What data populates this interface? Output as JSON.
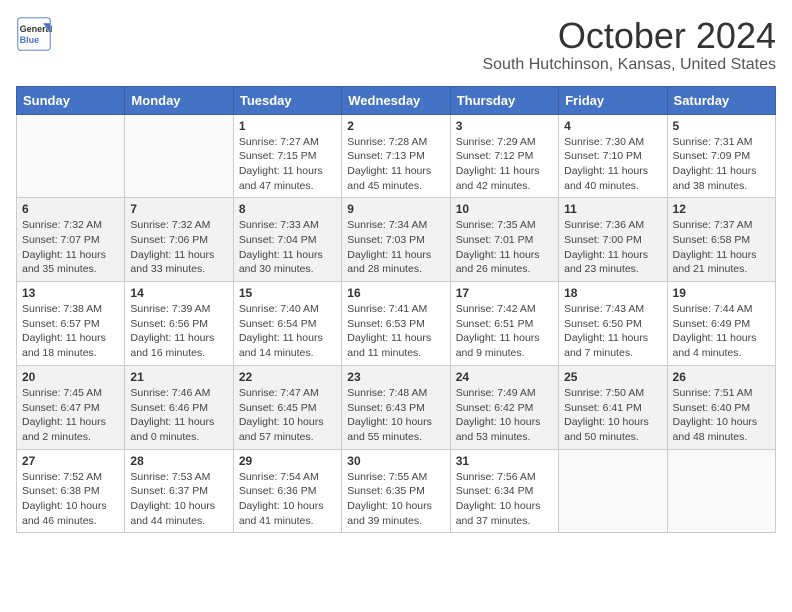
{
  "header": {
    "logo_line1": "General",
    "logo_line2": "Blue",
    "month_year": "October 2024",
    "location": "South Hutchinson, Kansas, United States"
  },
  "days_of_week": [
    "Sunday",
    "Monday",
    "Tuesday",
    "Wednesday",
    "Thursday",
    "Friday",
    "Saturday"
  ],
  "weeks": [
    [
      {
        "day": "",
        "info": ""
      },
      {
        "day": "",
        "info": ""
      },
      {
        "day": "1",
        "info": "Sunrise: 7:27 AM\nSunset: 7:15 PM\nDaylight: 11 hours and 47 minutes."
      },
      {
        "day": "2",
        "info": "Sunrise: 7:28 AM\nSunset: 7:13 PM\nDaylight: 11 hours and 45 minutes."
      },
      {
        "day": "3",
        "info": "Sunrise: 7:29 AM\nSunset: 7:12 PM\nDaylight: 11 hours and 42 minutes."
      },
      {
        "day": "4",
        "info": "Sunrise: 7:30 AM\nSunset: 7:10 PM\nDaylight: 11 hours and 40 minutes."
      },
      {
        "day": "5",
        "info": "Sunrise: 7:31 AM\nSunset: 7:09 PM\nDaylight: 11 hours and 38 minutes."
      }
    ],
    [
      {
        "day": "6",
        "info": "Sunrise: 7:32 AM\nSunset: 7:07 PM\nDaylight: 11 hours and 35 minutes."
      },
      {
        "day": "7",
        "info": "Sunrise: 7:32 AM\nSunset: 7:06 PM\nDaylight: 11 hours and 33 minutes."
      },
      {
        "day": "8",
        "info": "Sunrise: 7:33 AM\nSunset: 7:04 PM\nDaylight: 11 hours and 30 minutes."
      },
      {
        "day": "9",
        "info": "Sunrise: 7:34 AM\nSunset: 7:03 PM\nDaylight: 11 hours and 28 minutes."
      },
      {
        "day": "10",
        "info": "Sunrise: 7:35 AM\nSunset: 7:01 PM\nDaylight: 11 hours and 26 minutes."
      },
      {
        "day": "11",
        "info": "Sunrise: 7:36 AM\nSunset: 7:00 PM\nDaylight: 11 hours and 23 minutes."
      },
      {
        "day": "12",
        "info": "Sunrise: 7:37 AM\nSunset: 6:58 PM\nDaylight: 11 hours and 21 minutes."
      }
    ],
    [
      {
        "day": "13",
        "info": "Sunrise: 7:38 AM\nSunset: 6:57 PM\nDaylight: 11 hours and 18 minutes."
      },
      {
        "day": "14",
        "info": "Sunrise: 7:39 AM\nSunset: 6:56 PM\nDaylight: 11 hours and 16 minutes."
      },
      {
        "day": "15",
        "info": "Sunrise: 7:40 AM\nSunset: 6:54 PM\nDaylight: 11 hours and 14 minutes."
      },
      {
        "day": "16",
        "info": "Sunrise: 7:41 AM\nSunset: 6:53 PM\nDaylight: 11 hours and 11 minutes."
      },
      {
        "day": "17",
        "info": "Sunrise: 7:42 AM\nSunset: 6:51 PM\nDaylight: 11 hours and 9 minutes."
      },
      {
        "day": "18",
        "info": "Sunrise: 7:43 AM\nSunset: 6:50 PM\nDaylight: 11 hours and 7 minutes."
      },
      {
        "day": "19",
        "info": "Sunrise: 7:44 AM\nSunset: 6:49 PM\nDaylight: 11 hours and 4 minutes."
      }
    ],
    [
      {
        "day": "20",
        "info": "Sunrise: 7:45 AM\nSunset: 6:47 PM\nDaylight: 11 hours and 2 minutes."
      },
      {
        "day": "21",
        "info": "Sunrise: 7:46 AM\nSunset: 6:46 PM\nDaylight: 11 hours and 0 minutes."
      },
      {
        "day": "22",
        "info": "Sunrise: 7:47 AM\nSunset: 6:45 PM\nDaylight: 10 hours and 57 minutes."
      },
      {
        "day": "23",
        "info": "Sunrise: 7:48 AM\nSunset: 6:43 PM\nDaylight: 10 hours and 55 minutes."
      },
      {
        "day": "24",
        "info": "Sunrise: 7:49 AM\nSunset: 6:42 PM\nDaylight: 10 hours and 53 minutes."
      },
      {
        "day": "25",
        "info": "Sunrise: 7:50 AM\nSunset: 6:41 PM\nDaylight: 10 hours and 50 minutes."
      },
      {
        "day": "26",
        "info": "Sunrise: 7:51 AM\nSunset: 6:40 PM\nDaylight: 10 hours and 48 minutes."
      }
    ],
    [
      {
        "day": "27",
        "info": "Sunrise: 7:52 AM\nSunset: 6:38 PM\nDaylight: 10 hours and 46 minutes."
      },
      {
        "day": "28",
        "info": "Sunrise: 7:53 AM\nSunset: 6:37 PM\nDaylight: 10 hours and 44 minutes."
      },
      {
        "day": "29",
        "info": "Sunrise: 7:54 AM\nSunset: 6:36 PM\nDaylight: 10 hours and 41 minutes."
      },
      {
        "day": "30",
        "info": "Sunrise: 7:55 AM\nSunset: 6:35 PM\nDaylight: 10 hours and 39 minutes."
      },
      {
        "day": "31",
        "info": "Sunrise: 7:56 AM\nSunset: 6:34 PM\nDaylight: 10 hours and 37 minutes."
      },
      {
        "day": "",
        "info": ""
      },
      {
        "day": "",
        "info": ""
      }
    ]
  ]
}
